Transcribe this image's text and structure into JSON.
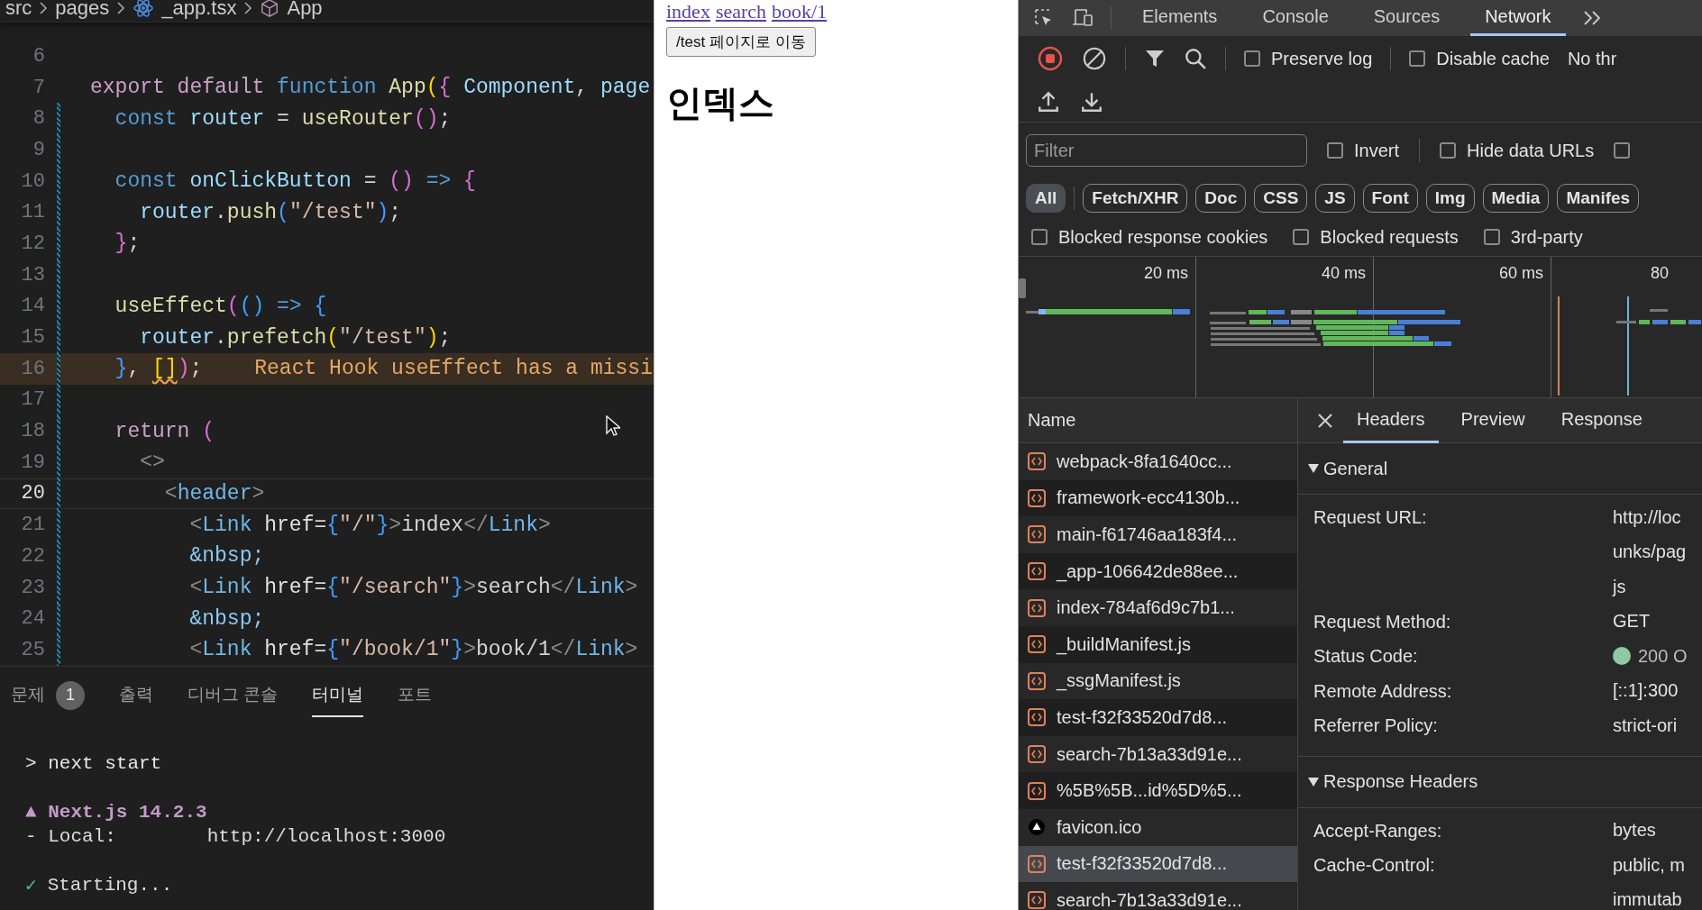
{
  "editor": {
    "breadcrumb": [
      {
        "kind": "folder",
        "label": "src"
      },
      {
        "kind": "folder",
        "label": "pages"
      },
      {
        "kind": "react-file",
        "label": "_app.tsx"
      },
      {
        "kind": "symbol",
        "label": "App"
      }
    ],
    "lines": [
      {
        "number": "6",
        "current": false,
        "modified": false
      },
      {
        "number": "7",
        "current": false,
        "modified": false,
        "tokens": [
          {
            "t": "export default ",
            "kind": "kw"
          },
          {
            "t": "function ",
            "kind": "st"
          },
          {
            "t": "App",
            "kind": "f"
          },
          {
            "t": "(",
            "kind": "y"
          },
          {
            "t": "{ ",
            "kind": "pk"
          },
          {
            "t": "Component",
            "kind": "v"
          },
          {
            "t": ", ",
            "kind": "p"
          },
          {
            "t": "page",
            "kind": "v"
          }
        ]
      },
      {
        "number": "8",
        "current": false,
        "modified": true,
        "tokens": [
          {
            "t": "  const ",
            "kind": "st"
          },
          {
            "t": "router",
            "kind": "v"
          },
          {
            "t": " = ",
            "kind": "p"
          },
          {
            "t": "useRouter",
            "kind": "f"
          },
          {
            "t": "()",
            "kind": "pk"
          },
          {
            "t": ";",
            "kind": "p"
          }
        ]
      },
      {
        "number": "9",
        "current": false,
        "modified": true
      },
      {
        "number": "10",
        "current": false,
        "modified": true,
        "tokens": [
          {
            "t": "  const ",
            "kind": "st"
          },
          {
            "t": "onClickButton",
            "kind": "v"
          },
          {
            "t": " = ",
            "kind": "p"
          },
          {
            "t": "()",
            "kind": "pk"
          },
          {
            "t": " => ",
            "kind": "st"
          },
          {
            "t": "{",
            "kind": "pk"
          }
        ]
      },
      {
        "number": "11",
        "current": false,
        "modified": true,
        "tokens": [
          {
            "t": "    router",
            "kind": "v"
          },
          {
            "t": ".",
            "kind": "p"
          },
          {
            "t": "push",
            "kind": "f"
          },
          {
            "t": "(",
            "kind": "b"
          },
          {
            "t": "\"/test\"",
            "kind": "s"
          },
          {
            "t": ")",
            "kind": "b"
          },
          {
            "t": ";",
            "kind": "p"
          }
        ]
      },
      {
        "number": "12",
        "current": false,
        "modified": true,
        "tokens": [
          {
            "t": "  }",
            "kind": "pk"
          },
          {
            "t": ";",
            "kind": "p"
          }
        ]
      },
      {
        "number": "13",
        "current": false,
        "modified": true
      },
      {
        "number": "14",
        "current": false,
        "modified": true,
        "tokens": [
          {
            "t": "  useEffect",
            "kind": "f"
          },
          {
            "t": "(",
            "kind": "pk"
          },
          {
            "t": "()",
            "kind": "b"
          },
          {
            "t": " => ",
            "kind": "st"
          },
          {
            "t": "{",
            "kind": "b"
          }
        ]
      },
      {
        "number": "15",
        "current": false,
        "modified": true,
        "tokens": [
          {
            "t": "    router",
            "kind": "v"
          },
          {
            "t": ".",
            "kind": "p"
          },
          {
            "t": "prefetch",
            "kind": "f"
          },
          {
            "t": "(",
            "kind": "y"
          },
          {
            "t": "\"/test\"",
            "kind": "s"
          },
          {
            "t": ")",
            "kind": "y"
          },
          {
            "t": ";",
            "kind": "p"
          }
        ]
      },
      {
        "number": "16",
        "current": false,
        "modified": true,
        "tokens": [
          {
            "t": "  }",
            "kind": "b"
          },
          {
            "t": ", ",
            "kind": "p"
          },
          {
            "t": "[]",
            "kind": "wsq"
          },
          {
            "t": ")",
            "kind": "pk"
          },
          {
            "t": ";",
            "kind": "p"
          }
        ],
        "diagnostic": "React Hook useEffect has a missi"
      },
      {
        "number": "17",
        "current": false,
        "modified": true
      },
      {
        "number": "18",
        "current": false,
        "modified": true,
        "tokens": [
          {
            "t": "  return ",
            "kind": "kw"
          },
          {
            "t": "(",
            "kind": "pk"
          }
        ]
      },
      {
        "number": "19",
        "current": false,
        "modified": true,
        "tokens": [
          {
            "t": "    <>",
            "kind": "g"
          }
        ]
      },
      {
        "number": "20",
        "current": true,
        "modified": true,
        "tokens": [
          {
            "t": "      <",
            "kind": "g"
          },
          {
            "t": "header",
            "kind": "tag"
          },
          {
            "t": ">",
            "kind": "g"
          }
        ]
      },
      {
        "number": "21",
        "current": false,
        "modified": true,
        "tokens": [
          {
            "t": "        <",
            "kind": "g"
          },
          {
            "t": "Link",
            "kind": "tag"
          },
          {
            "t": " href",
            "kind": "a"
          },
          {
            "t": "=",
            "kind": "p"
          },
          {
            "t": "{",
            "kind": "b"
          },
          {
            "t": "\"/\"",
            "kind": "s"
          },
          {
            "t": "}",
            "kind": "b"
          },
          {
            "t": ">",
            "kind": "g"
          },
          {
            "t": "index",
            "kind": "p"
          },
          {
            "t": "</",
            "kind": "g"
          },
          {
            "t": "Link",
            "kind": "tag"
          },
          {
            "t": ">",
            "kind": "g"
          }
        ]
      },
      {
        "number": "22",
        "current": false,
        "modified": true,
        "tokens": [
          {
            "t": "        &nbsp;",
            "kind": "e"
          }
        ]
      },
      {
        "number": "23",
        "current": false,
        "modified": true,
        "tokens": [
          {
            "t": "        <",
            "kind": "g"
          },
          {
            "t": "Link",
            "kind": "tag"
          },
          {
            "t": " href",
            "kind": "a"
          },
          {
            "t": "=",
            "kind": "p"
          },
          {
            "t": "{",
            "kind": "b"
          },
          {
            "t": "\"/search\"",
            "kind": "s"
          },
          {
            "t": "}",
            "kind": "b"
          },
          {
            "t": ">",
            "kind": "g"
          },
          {
            "t": "search",
            "kind": "p"
          },
          {
            "t": "</",
            "kind": "g"
          },
          {
            "t": "Link",
            "kind": "tag"
          },
          {
            "t": ">",
            "kind": "g"
          }
        ]
      },
      {
        "number": "24",
        "current": false,
        "modified": true,
        "tokens": [
          {
            "t": "        &nbsp;",
            "kind": "e"
          }
        ]
      },
      {
        "number": "25",
        "current": false,
        "modified": true,
        "tokens": [
          {
            "t": "        <",
            "kind": "g"
          },
          {
            "t": "Link",
            "kind": "tag"
          },
          {
            "t": " href",
            "kind": "a"
          },
          {
            "t": "=",
            "kind": "p"
          },
          {
            "t": "{",
            "kind": "b"
          },
          {
            "t": "\"/book/1\"",
            "kind": "s"
          },
          {
            "t": "}",
            "kind": "b"
          },
          {
            "t": ">",
            "kind": "g"
          },
          {
            "t": "book/1",
            "kind": "p"
          },
          {
            "t": "</",
            "kind": "g"
          },
          {
            "t": "Link",
            "kind": "tag"
          },
          {
            "t": ">",
            "kind": "g"
          }
        ]
      }
    ]
  },
  "panel": {
    "tabs": [
      {
        "label": "문제",
        "badge": "1",
        "selected": false
      },
      {
        "label": "출력",
        "selected": false
      },
      {
        "label": "디버그 콘솔",
        "selected": false
      },
      {
        "label": "터미널",
        "selected": true
      },
      {
        "label": "포트",
        "selected": false
      }
    ],
    "terminal": [
      {
        "kind": "command",
        "text": "> next start"
      },
      {
        "kind": "heading",
        "text": "▲ Next.js 14.2.3"
      },
      {
        "kind": "info",
        "text": "- Local:        http://localhost:3000"
      },
      {
        "kind": "success",
        "mark": "✓",
        "text": "Starting..."
      }
    ]
  },
  "browser": {
    "links": [
      "index",
      "search",
      "book/1"
    ],
    "button": "/test 페이지로 이동",
    "heading": "인덱스"
  },
  "devtools": {
    "tabs": [
      {
        "label": "Elements",
        "selected": false
      },
      {
        "label": "Console",
        "selected": false
      },
      {
        "label": "Sources",
        "selected": false
      },
      {
        "label": "Network",
        "selected": true
      }
    ],
    "recording": true,
    "toolbar_checkboxes": [
      {
        "label": "Preserve log",
        "checked": false
      },
      {
        "label": "Disable cache",
        "checked": false
      }
    ],
    "throttling": "No thr",
    "filter": {
      "placeholder": "Filter"
    },
    "filter_checkboxes": [
      {
        "label": "Invert",
        "checked": false
      },
      {
        "label": "Hide data URLs",
        "checked": false
      },
      {
        "checked": false
      }
    ],
    "type_chips": [
      {
        "label": "All",
        "selected": true
      },
      {
        "label": "Fetch/XHR",
        "selected": false
      },
      {
        "label": "Doc",
        "selected": false
      },
      {
        "label": "CSS",
        "selected": false
      },
      {
        "label": "JS",
        "selected": false
      },
      {
        "label": "Font",
        "selected": false
      },
      {
        "label": "Img",
        "selected": false
      },
      {
        "label": "Media",
        "selected": false
      },
      {
        "label": "Manifes",
        "selected": false
      }
    ],
    "blocked_checkboxes": [
      {
        "label": "Blocked response cookies",
        "checked": false
      },
      {
        "label": "Blocked requests",
        "checked": false
      },
      {
        "label": "3rd-party",
        "checked": false
      }
    ],
    "overview": {
      "ticks": [
        "20 ms",
        "40 ms",
        "60 ms",
        "80"
      ]
    },
    "requests": {
      "column": "Name",
      "rows": [
        {
          "name": "webpack-8fa1640cc...",
          "kind": "script",
          "selected": false
        },
        {
          "name": "framework-ecc4130b...",
          "kind": "script",
          "selected": false
        },
        {
          "name": "main-f61746aa183f4...",
          "kind": "script",
          "selected": false
        },
        {
          "name": "_app-106642de88ee...",
          "kind": "script",
          "selected": false
        },
        {
          "name": "index-784af6d9c7b1...",
          "kind": "script",
          "selected": false
        },
        {
          "name": "_buildManifest.js",
          "kind": "script",
          "selected": false
        },
        {
          "name": "_ssgManifest.js",
          "kind": "script",
          "selected": false
        },
        {
          "name": "test-f32f33520d7d8...",
          "kind": "script",
          "selected": false
        },
        {
          "name": "search-7b13a33d91e...",
          "kind": "script",
          "selected": false
        },
        {
          "name": "%5B%5B...id%5D%5...",
          "kind": "script",
          "selected": false
        },
        {
          "name": "favicon.ico",
          "kind": "favicon",
          "selected": false
        },
        {
          "name": "test-f32f33520d7d8...",
          "kind": "script",
          "selected": true
        },
        {
          "name": "search-7b13a33d91e...",
          "kind": "script",
          "selected": false
        }
      ]
    },
    "details": {
      "tabs": [
        {
          "label": "Headers",
          "selected": true
        },
        {
          "label": "Preview",
          "selected": false
        },
        {
          "label": "Response",
          "selected": false
        }
      ],
      "sections": [
        {
          "title": "General",
          "expanded": true,
          "rows": [
            {
              "name": "Request URL:",
              "value": [
                "http://loc",
                "unks/pag",
                "js"
              ]
            },
            {
              "name": "Request Method:",
              "value": [
                "GET"
              ]
            },
            {
              "name": "Status Code:",
              "value": [
                "200 O"
              ],
              "color": "#8fc9a3"
            },
            {
              "name": "Remote Address:",
              "value": [
                "[::1]:300"
              ]
            },
            {
              "name": "Referrer Policy:",
              "value": [
                "strict-ori"
              ]
            }
          ]
        },
        {
          "title": "Response Headers",
          "expanded": true,
          "rows": [
            {
              "name": "Accept-Ranges:",
              "value": [
                "bytes"
              ]
            },
            {
              "name": "Cache-Control:",
              "value": [
                "public, m",
                "immutab"
              ]
            }
          ]
        }
      ]
    }
  }
}
